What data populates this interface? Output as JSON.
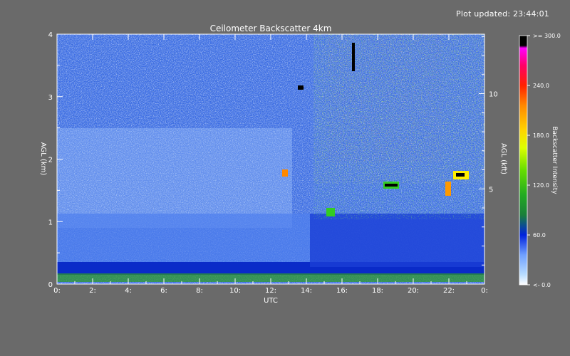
{
  "updated_text": "Plot updated: 23:44:01",
  "chart_data": {
    "type": "heatmap",
    "title": "Ceilometer Backscatter 4km",
    "xlabel": "UTC",
    "ylabel_left": "AGL (km)",
    "ylabel_right": "AGL (kft)",
    "colorbar_label": "Backscatter Intensity",
    "x_range": [
      0,
      24
    ],
    "y_range_km": [
      0,
      4
    ],
    "x_ticks": [
      0,
      2,
      4,
      6,
      8,
      10,
      12,
      14,
      16,
      18,
      20,
      22,
      0
    ],
    "x_tick_labels": [
      "0:",
      "2:",
      "4:",
      "6:",
      "8:",
      "10:",
      "12:",
      "14:",
      "16:",
      "18:",
      "20:",
      "22:",
      "0:"
    ],
    "y_ticks_left": [
      0,
      1,
      2,
      3,
      4
    ],
    "y_tick_labels_left": [
      "0",
      "1",
      "2",
      "3",
      "4"
    ],
    "y_ticks_right_kft": [
      5,
      10
    ],
    "y_tick_labels_right": [
      "5",
      "10"
    ],
    "colorbar_range": [
      0,
      300
    ],
    "colorbar_ticks": [
      {
        "value": 0,
        "label": "<-   0.0"
      },
      {
        "value": 60,
        "label": "60.0"
      },
      {
        "value": 120,
        "label": "120.0"
      },
      {
        "value": 180,
        "label": "180.0"
      },
      {
        "value": 240,
        "label": "240.0"
      },
      {
        "value": 300,
        "label": ">= 300.0"
      }
    ],
    "colorscale": [
      "#ffffff",
      "#b9ddff",
      "#6f9fff",
      "#2f5fff",
      "#0022dd",
      "#1b8f2b",
      "#33cc22",
      "#99ee00",
      "#ffff00",
      "#ffaa00",
      "#ff4400",
      "#ff0000",
      "#ff0077",
      "#ff00ff",
      "#000000"
    ]
  }
}
